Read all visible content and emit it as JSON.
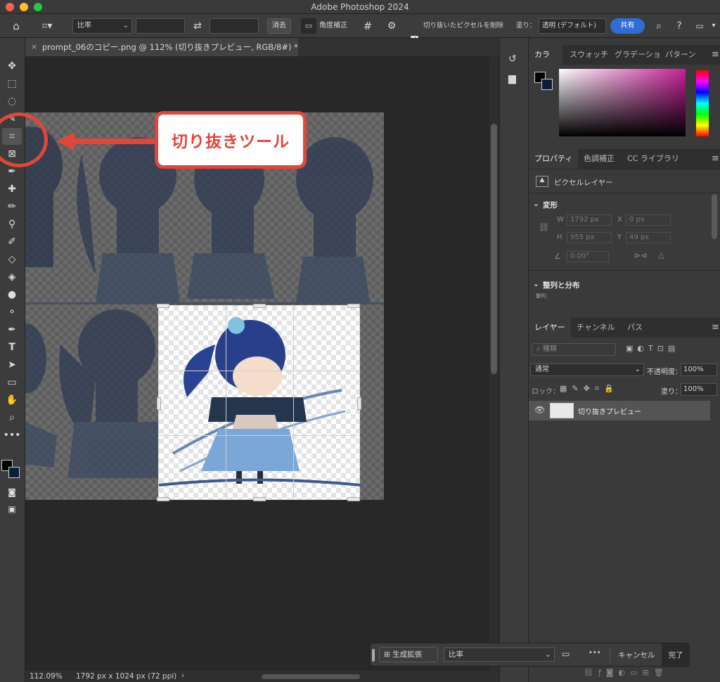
{
  "window": {
    "title": "Adobe Photoshop 2024"
  },
  "options_bar": {
    "ratio_select": "比率",
    "clear_label": "消去",
    "straighten_label": "角度補正",
    "delete_cropped_label": "切り抜いたピクセルを削除",
    "fill_label": "塗り：",
    "fill_value": "透明 (デフォルト)",
    "share_label": "共有"
  },
  "document": {
    "tab_title": "prompt_06のコピー.png @ 112% (切り抜きプレビュー, RGB/8#) *"
  },
  "annotation": {
    "callout_text": "切り抜きツール"
  },
  "status": {
    "zoom": "112.09%",
    "doc_info": "1792 px x 1024 px (72 ppi)"
  },
  "color_panel": {
    "tabs": [
      "カラー",
      "スウォッチ",
      "グラデーショ",
      "パターン"
    ]
  },
  "properties_panel": {
    "tabs": [
      "プロパティ",
      "色調補正",
      "CC ライブラリ"
    ],
    "layer_type": "ピクセルレイヤー",
    "transform_title": "変形",
    "w_label": "W",
    "w_value": "1792 px",
    "x_label": "X",
    "x_value": "0 px",
    "h_label": "H",
    "h_value": "955 px",
    "y_label": "Y",
    "y_value": "49 px",
    "angle_value": "0.00°",
    "align_title": "整列と分布",
    "align_sub": "整列："
  },
  "layers_panel": {
    "tabs": [
      "レイヤー",
      "チャンネル",
      "パス"
    ],
    "search_placeholder": "種類",
    "blend_mode": "通常",
    "opacity_label": "不透明度：",
    "opacity_value": "100%",
    "lock_label": "ロック：",
    "fill_label": "塗り：",
    "fill_value": "100%",
    "layer_name": "切り抜きプレビュー"
  },
  "crop_bar": {
    "generative_expand": "生成拡張",
    "ratio_select": "比率",
    "more": "•••",
    "cancel": "キャンセル",
    "done": "完了"
  },
  "colors": {
    "accent": "#2f6cd6",
    "callout": "#e2463a"
  }
}
